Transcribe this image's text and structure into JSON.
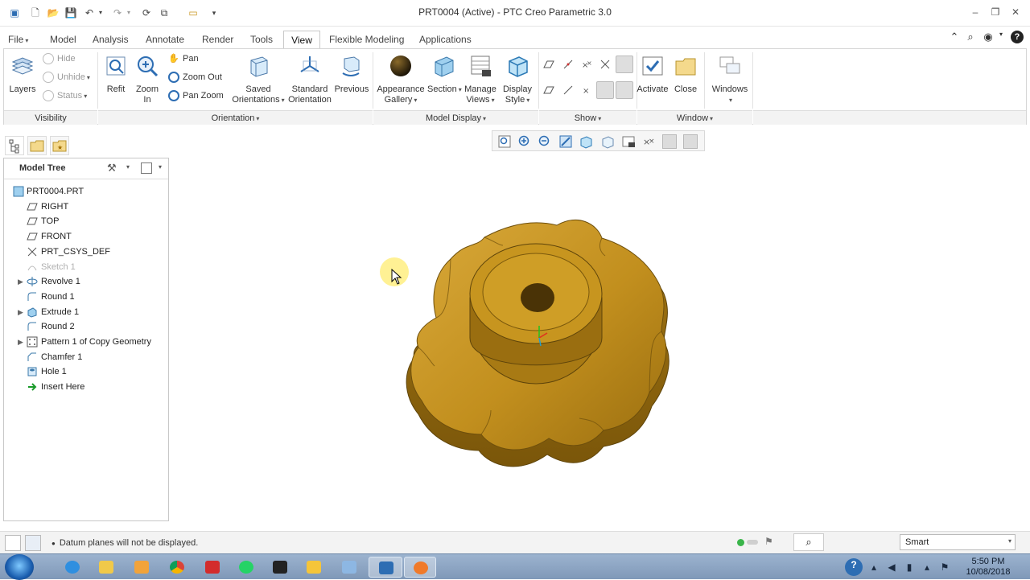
{
  "window": {
    "title": "PRT0004 (Active) - PTC Creo Parametric 3.0",
    "controls": [
      "–",
      "❐",
      "✕"
    ]
  },
  "tabs": [
    {
      "label": "File"
    },
    {
      "label": "Model"
    },
    {
      "label": "Analysis"
    },
    {
      "label": "Annotate"
    },
    {
      "label": "Render"
    },
    {
      "label": "Tools"
    },
    {
      "label": "View"
    },
    {
      "label": "Flexible Modeling"
    },
    {
      "label": "Applications"
    }
  ],
  "ribbon": {
    "visibility": {
      "layers": "Layers",
      "hide": "Hide",
      "unhide": "Unhide",
      "status": "Status",
      "group": "Visibility"
    },
    "orientation": {
      "refit": "Refit",
      "zoom_in": "Zoom In",
      "pan": "Pan",
      "zoom_out": "Zoom Out",
      "pan_zoom": "Pan Zoom",
      "saved_line1": "Saved",
      "saved_line2": "Orientations",
      "standard_line1": "Standard",
      "standard_line2": "Orientation",
      "previous": "Previous",
      "group": "Orientation"
    },
    "model_display": {
      "appearance_line1": "Appearance",
      "appearance_line2": "Gallery",
      "section": "Section",
      "manage_line1": "Manage",
      "manage_line2": "Views",
      "display_line1": "Display",
      "display_line2": "Style",
      "group": "Model Display"
    },
    "show": {
      "group": "Show"
    },
    "window": {
      "activate": "Activate",
      "close": "Close",
      "windows": "Windows",
      "group": "Window"
    }
  },
  "model_tree": {
    "title": "Model Tree",
    "items": [
      {
        "label": "PRT0004.PRT",
        "icon": "part-icon",
        "expand": false,
        "disabled": false
      },
      {
        "label": "RIGHT",
        "icon": "datum-plane-icon",
        "expand": false,
        "disabled": false
      },
      {
        "label": "TOP",
        "icon": "datum-plane-icon",
        "expand": false,
        "disabled": false
      },
      {
        "label": "FRONT",
        "icon": "datum-plane-icon",
        "expand": false,
        "disabled": false
      },
      {
        "label": "PRT_CSYS_DEF",
        "icon": "csys-icon",
        "expand": false,
        "disabled": false
      },
      {
        "label": "Sketch 1",
        "icon": "sketch-icon",
        "expand": false,
        "disabled": true
      },
      {
        "label": "Revolve 1",
        "icon": "revolve-icon",
        "expand": true,
        "disabled": false
      },
      {
        "label": "Round 1",
        "icon": "round-icon",
        "expand": false,
        "disabled": false
      },
      {
        "label": "Extrude 1",
        "icon": "extrude-icon",
        "expand": true,
        "disabled": false
      },
      {
        "label": "Round 2",
        "icon": "round-icon",
        "expand": false,
        "disabled": false
      },
      {
        "label": "Pattern 1 of Copy Geometry",
        "icon": "pattern-icon",
        "expand": true,
        "disabled": false
      },
      {
        "label": "Chamfer 1",
        "icon": "chamfer-icon",
        "expand": false,
        "disabled": false
      },
      {
        "label": "Hole 1",
        "icon": "hole-icon",
        "expand": false,
        "disabled": false
      },
      {
        "label": "Insert Here",
        "icon": "insert-here-icon",
        "expand": false,
        "disabled": false
      }
    ]
  },
  "status": {
    "message": "Datum planes will not be displayed.",
    "filter": "Smart"
  },
  "clock": {
    "time": "5:50 PM",
    "date": "10/08/2018"
  },
  "colors": {
    "model": "#c9951d",
    "model_dark": "#8a6410",
    "accent": "#2d6db3"
  }
}
